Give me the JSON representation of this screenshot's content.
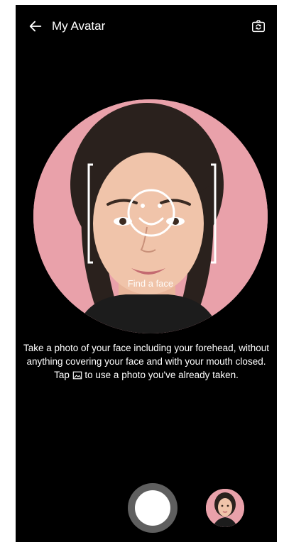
{
  "header": {
    "back_icon": "arrow-left-icon",
    "title": "My Avatar",
    "switch_camera_icon": "camera-switch-icon"
  },
  "viewfinder": {
    "background_color": "#e9a1aa",
    "guide_label": "Find a face",
    "guide_icon": "smiley-face-icon"
  },
  "instructions": {
    "line1": "Take a photo of your face including your forehead, without anything covering your face and with your mouth closed.",
    "line2_prefix": "Tap",
    "line2_icon": "gallery-icon",
    "line2_suffix": "to use a photo you've already taken."
  },
  "controls": {
    "shutter_icon": "shutter-button",
    "gallery_thumbnail": "recent-photo-thumbnail"
  }
}
